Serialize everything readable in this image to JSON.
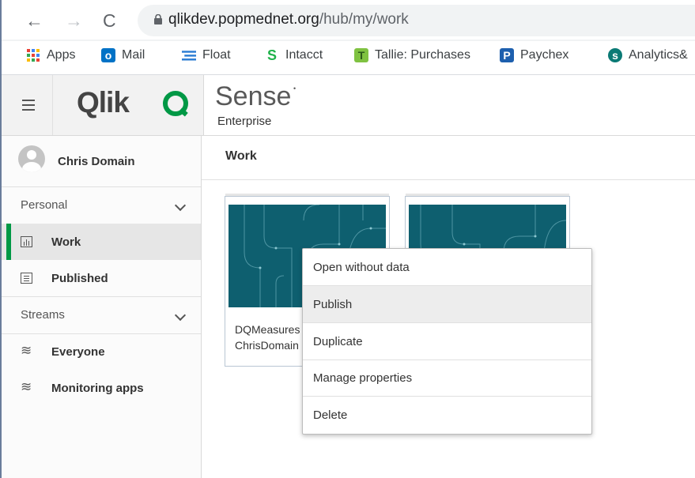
{
  "browser": {
    "url_host": "qlikdev.popmednet.org",
    "url_path": "/hub/my/work",
    "back_icon": "←",
    "forward_icon": "→",
    "reload_icon": "C",
    "bookmarks": [
      {
        "label": "Apps",
        "icon": "apps-grid-icon"
      },
      {
        "label": "Mail",
        "icon": "outlook-icon"
      },
      {
        "label": "Float",
        "icon": "float-icon"
      },
      {
        "label": "Intacct",
        "icon": "intacct-icon"
      },
      {
        "label": "Tallie: Purchases",
        "icon": "tallie-icon"
      },
      {
        "label": "Paychex",
        "icon": "paychex-icon"
      },
      {
        "label": "Analytics&",
        "icon": "sharepoint-icon"
      }
    ]
  },
  "header": {
    "brand": "Qlik",
    "product": "Sense",
    "edition": "Enterprise"
  },
  "sidebar": {
    "user_name": "Chris Domain",
    "personal_label": "Personal",
    "personal_items": [
      {
        "label": "Work",
        "active": true
      },
      {
        "label": "Published",
        "active": false
      }
    ],
    "streams_label": "Streams",
    "stream_items": [
      {
        "label": "Everyone"
      },
      {
        "label": "Monitoring apps"
      }
    ]
  },
  "main": {
    "title": "Work",
    "cards": [
      {
        "title_line1": "DQMeasures",
        "title_line2": "ChrisDomain"
      },
      {
        "title_line1": "",
        "title_line2": ""
      }
    ]
  },
  "context_menu": {
    "items": [
      "Open without data",
      "Publish",
      "Duplicate",
      "Manage properties",
      "Delete"
    ],
    "highlighted": "Publish"
  },
  "colors": {
    "qlik_green": "#009845",
    "thumb_teal": "#0e5f6f"
  }
}
